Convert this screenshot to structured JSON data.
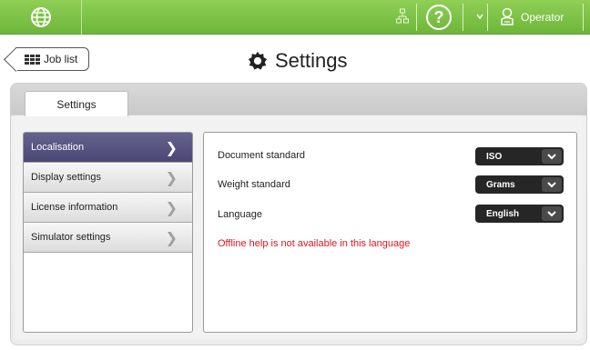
{
  "topbar": {
    "logo_icon": "globe-icon",
    "network_icon": "network-icon",
    "help_icon": "help-icon",
    "help_glyph": "?",
    "operator_icon": "operator-icon",
    "operator_label": "Operator"
  },
  "header": {
    "job_list_label": "Job list",
    "title": "Settings",
    "title_icon": "gear-icon"
  },
  "tab": {
    "label": "Settings"
  },
  "menu": {
    "items": [
      {
        "label": "Localisation"
      },
      {
        "label": "Display settings"
      },
      {
        "label": "License information"
      },
      {
        "label": "Simulator settings"
      }
    ]
  },
  "localisation": {
    "document_standard": {
      "label": "Document standard",
      "value": "ISO"
    },
    "weight_standard": {
      "label": "Weight standard",
      "value": "Grams"
    },
    "language": {
      "label": "Language",
      "value": "English"
    },
    "warning": "Offline help is not available in this language"
  },
  "colors": {
    "topbar": "#7cc24a",
    "menu_active": "#57537f",
    "warning": "#e0141e"
  }
}
